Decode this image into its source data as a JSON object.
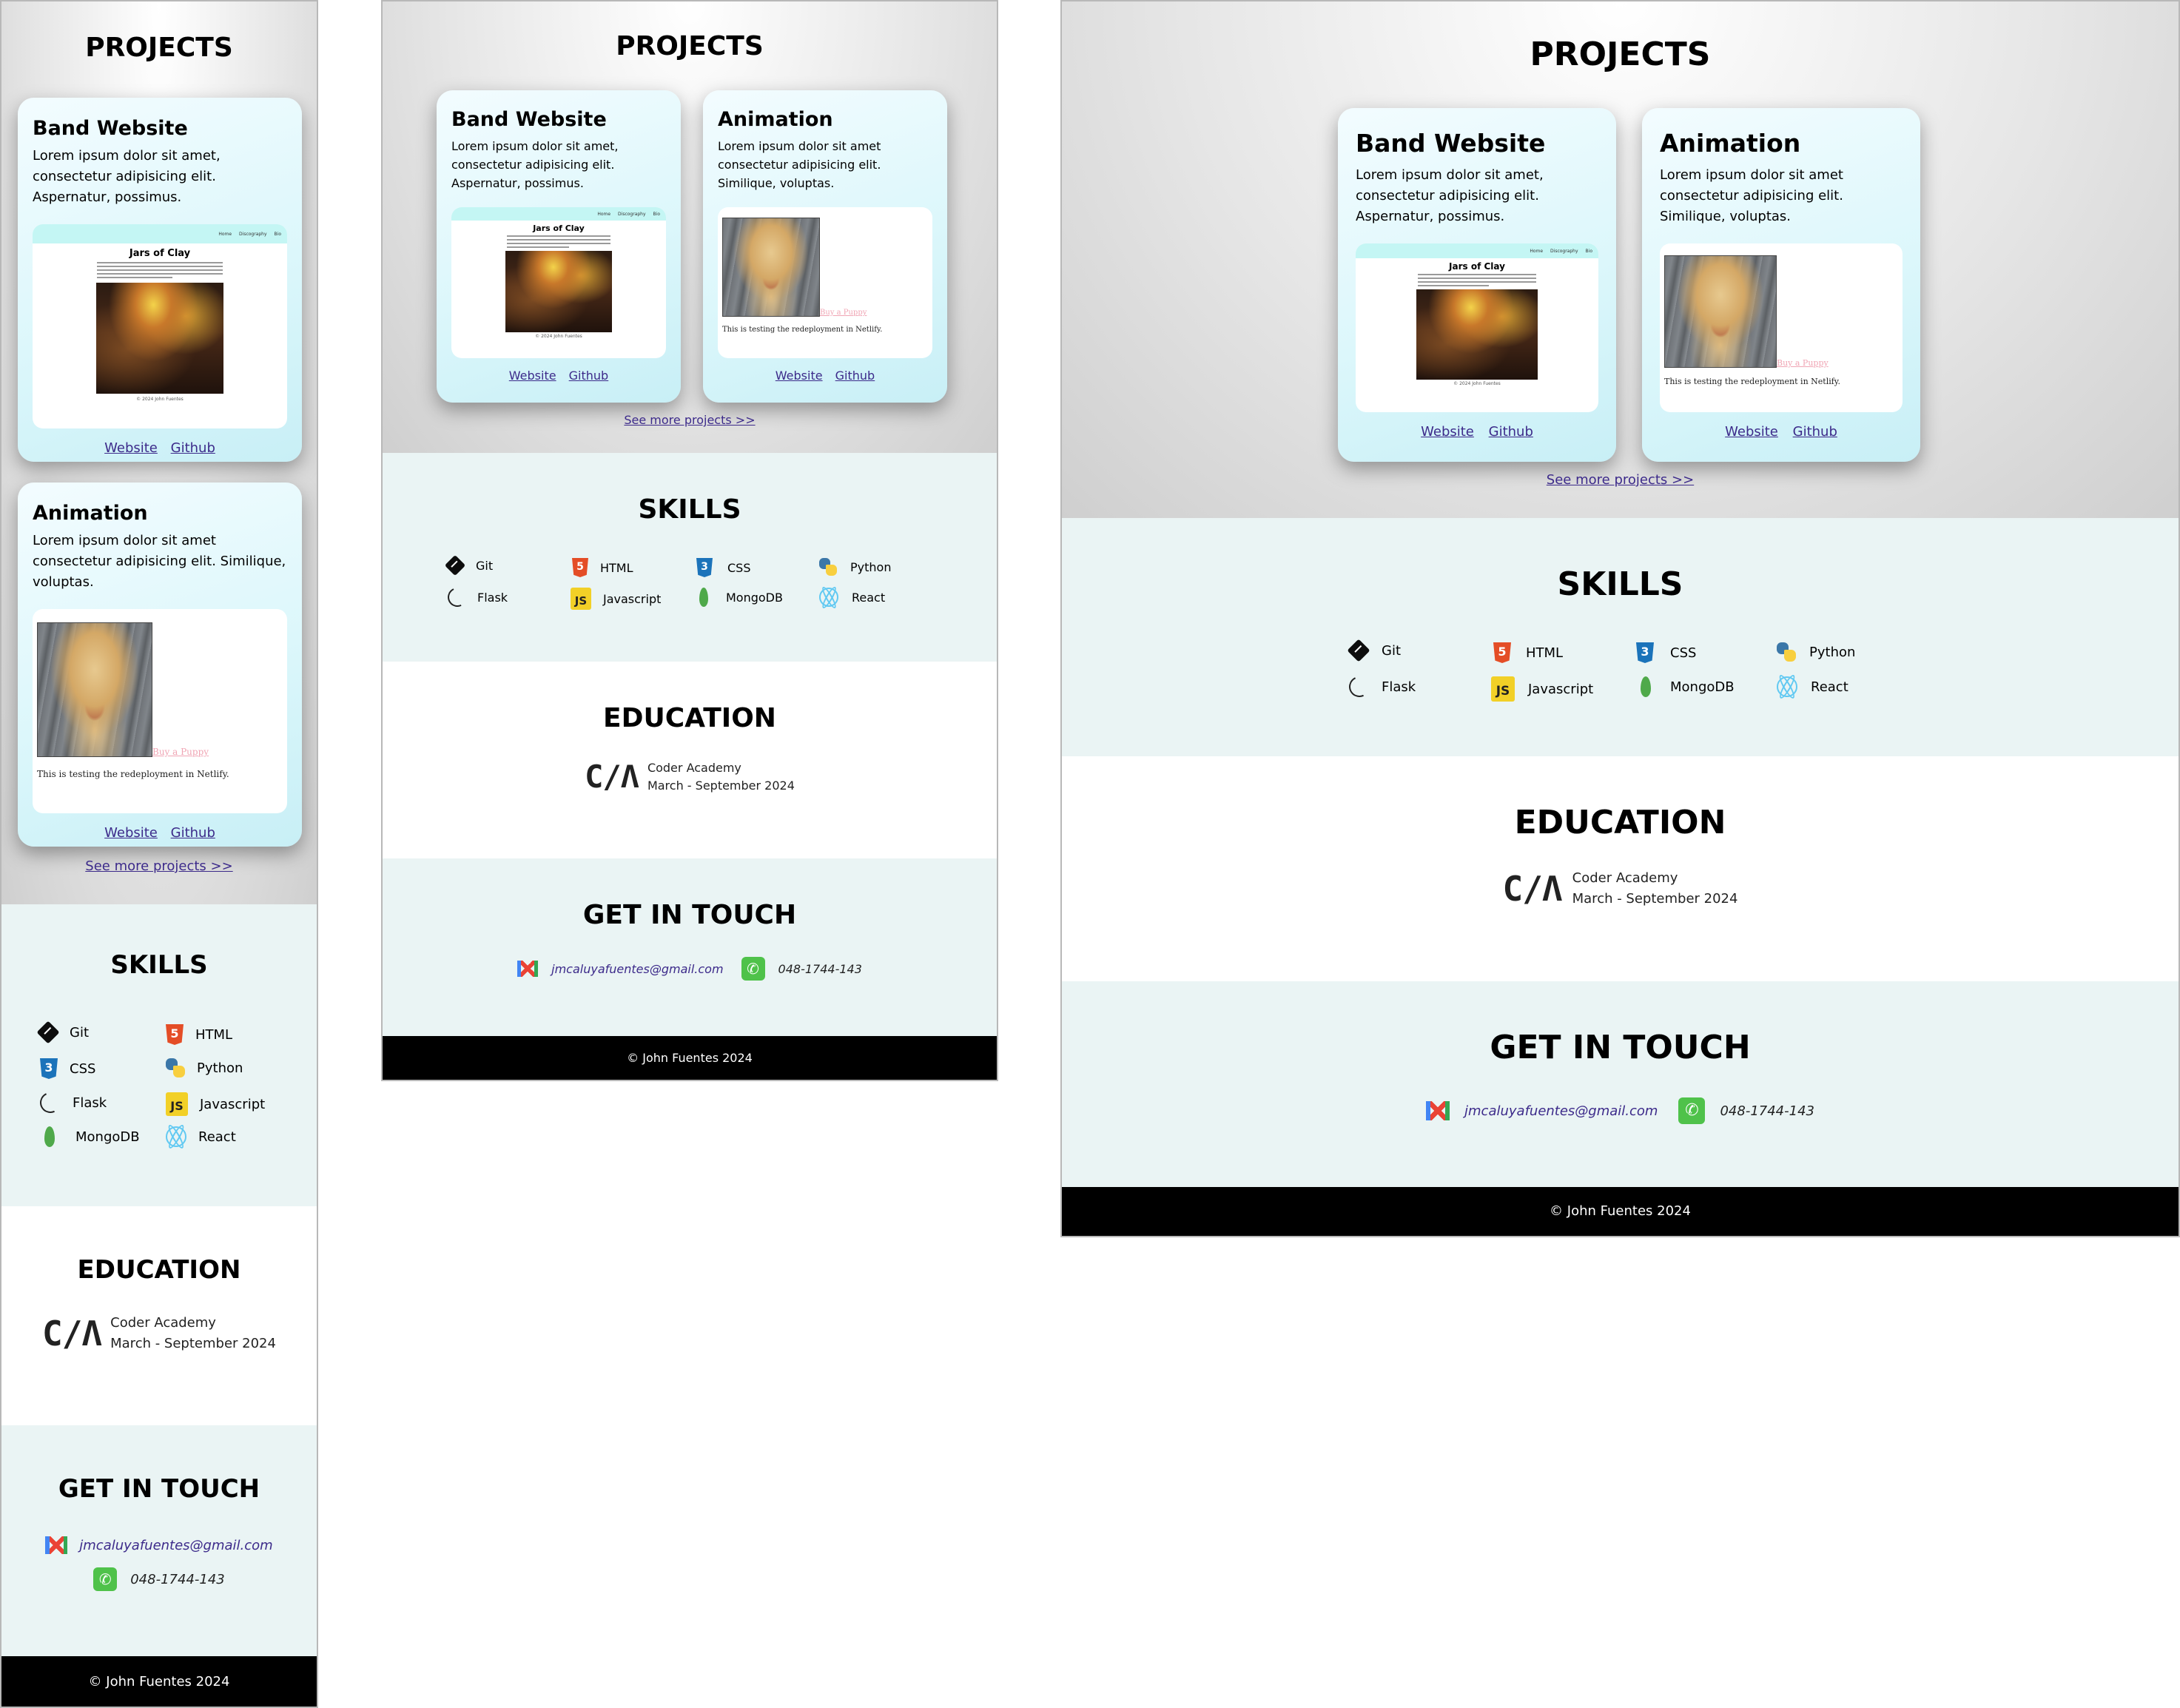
{
  "projects": {
    "title": "PROJECTS",
    "cards": [
      {
        "title": "Band Website",
        "description": "Lorem ipsum dolor sit amet, consectetur adipisicing elit. Aspernatur, possimus.",
        "preview": {
          "nav": [
            "Home",
            "Discography",
            "Bio"
          ],
          "title": "Jars of Clay",
          "footer": "© 2024 John Fuentes"
        },
        "links": {
          "website": "Website",
          "github": "Github"
        }
      },
      {
        "title": "Animation",
        "description": "Lorem ipsum dolor sit amet consectetur adipisicing elit. Similique, voluptas.",
        "preview": {
          "link": "Buy a Puppy",
          "text": "This is testing the redeployment in Netlify."
        },
        "links": {
          "website": "Website",
          "github": "Github"
        }
      }
    ],
    "more": "See more projects >>"
  },
  "skills": {
    "title": "SKILLS",
    "items": [
      {
        "name": "Git",
        "icon": "git-icon"
      },
      {
        "name": "HTML",
        "icon": "html5-icon"
      },
      {
        "name": "CSS",
        "icon": "css3-icon"
      },
      {
        "name": "Python",
        "icon": "python-icon"
      },
      {
        "name": "Flask",
        "icon": "flask-icon"
      },
      {
        "name": "Javascript",
        "icon": "javascript-icon"
      },
      {
        "name": "MongoDB",
        "icon": "mongodb-icon"
      },
      {
        "name": "React",
        "icon": "react-icon"
      }
    ]
  },
  "education": {
    "title": "EDUCATION",
    "logo": "C/Λ",
    "school": "Coder Academy",
    "dates": "March - September 2024"
  },
  "contact": {
    "title": "GET IN TOUCH",
    "email": "jmcaluyafuentes@gmail.com",
    "phone": "048-1744-143"
  },
  "footer": {
    "text": "© John Fuentes 2024"
  },
  "colors": {
    "accent_link": "#3c2a8a",
    "card_bg": "#dcf7fb",
    "section_tint": "#eaf4f4",
    "phone_green": "#4fc24a"
  }
}
